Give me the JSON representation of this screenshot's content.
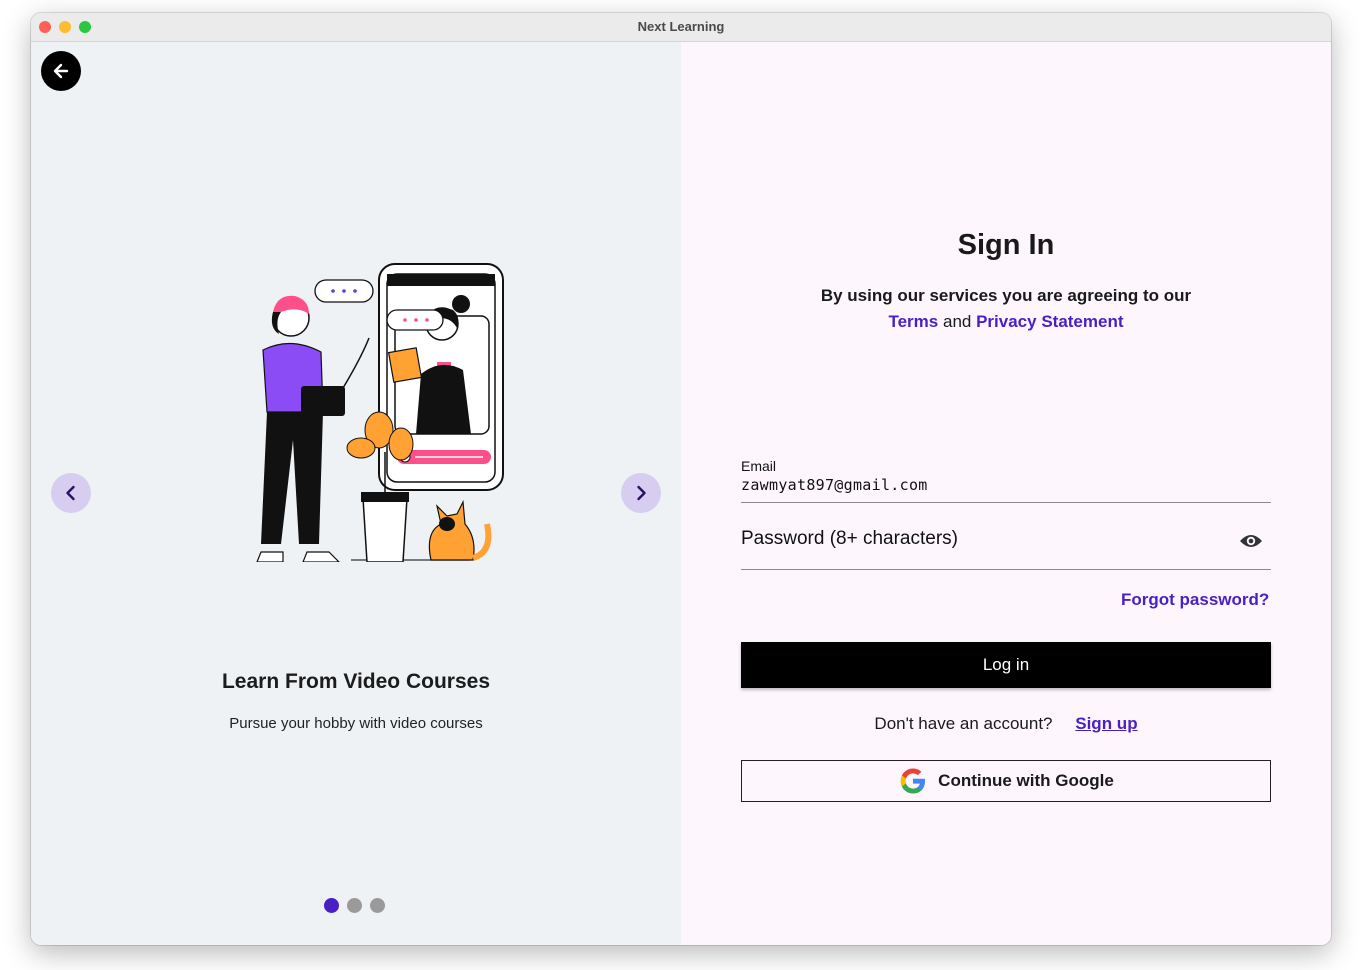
{
  "window": {
    "title": "Next Learning"
  },
  "carousel": {
    "slide_title": "Learn From Video Courses",
    "slide_subtitle": "Pursue your hobby with video courses",
    "active_index": 1,
    "total_slides": 3
  },
  "signin": {
    "title": "Sign In",
    "agree_text": "By using our services you are agreeing to our",
    "terms_label": "Terms",
    "and_text": "and",
    "privacy_label": "Privacy Statement",
    "email_label": "Email",
    "email_value": "zawmyat897@gmail.com",
    "password_placeholder": "Password (8+ characters)",
    "forgot_label": "Forgot password?",
    "login_label": "Log in",
    "no_account_text": "Don't have an account?",
    "signup_label": "Sign up",
    "google_label": "Continue with Google"
  },
  "colors": {
    "accent": "#4a1fc4",
    "nav_button_bg": "#d6cdf0",
    "left_panel_bg": "#eef2f5",
    "right_panel_bg": "#fdf7fd"
  },
  "icons": [
    "back-arrow-icon",
    "chevron-left-icon",
    "chevron-right-icon",
    "eye-icon",
    "google-icon"
  ]
}
